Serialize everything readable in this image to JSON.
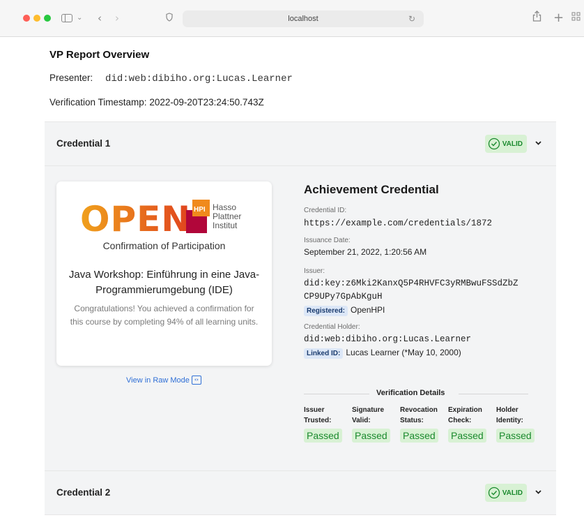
{
  "browser": {
    "address": "localhost"
  },
  "report": {
    "title": "VP Report Overview",
    "presenter_label": "Presenter:",
    "presenter_value": "did:web:dibiho.org:Lucas.Learner",
    "timestamp_label": "Verification Timestamp:",
    "timestamp_value": "2022-09-20T23:24:50.743Z"
  },
  "credentials": [
    {
      "title": "Credential 1",
      "status": "VALID"
    },
    {
      "title": "Credential 2",
      "status": "VALID"
    }
  ],
  "card": {
    "logo_text": "OPEN",
    "logo_badge": "HPI",
    "logo_org_1": "Hasso",
    "logo_org_2": "Plattner",
    "logo_org_3": "Institut",
    "subtitle": "Confirmation of Participation",
    "course": "Java Workshop: Einführung in eine Java- Programmierumgebung (IDE)",
    "description": "Congratulations! You achieved a confirmation for this course by completing 94% of all learning units.",
    "raw_link": "View in Raw Mode"
  },
  "details": {
    "heading": "Achievement Credential",
    "credential_id_label": "Credential ID:",
    "credential_id": "https://example.com/credentials/1872",
    "issuance_label": "Issuance Date:",
    "issuance_date": "September 21, 2022, 1:20:56 AM",
    "issuer_label": "Issuer:",
    "issuer_line1": "did:key:z6Mki2KanxQ5P4RHVFC3yRMBwuFSSdZbZ",
    "issuer_line2": "CP9UPy7GpAbKguH",
    "registered_tag": "Registered:",
    "registered_value": "OpenHPI",
    "holder_label": "Credential Holder:",
    "holder": "did:web:dibiho.org:Lucas.Learner",
    "linked_tag": "Linked ID:",
    "linked_value": "Lucas Learner (*May 10, 2000)"
  },
  "verification": {
    "title": "Verification Details",
    "checks": [
      {
        "l1": "Issuer",
        "l2": "Trusted:",
        "result": "Passed"
      },
      {
        "l1": "Signature",
        "l2": "Valid:",
        "result": "Passed"
      },
      {
        "l1": "Revocation",
        "l2": "Status:",
        "result": "Passed"
      },
      {
        "l1": "Expiration",
        "l2": "Check:",
        "result": "Passed"
      },
      {
        "l1": "Holder",
        "l2": "Identity:",
        "result": "Passed"
      }
    ]
  },
  "colors": {
    "valid_bg": "#d8f1d4",
    "valid_text": "#1b8a2e",
    "link": "#2f6fd6",
    "logo_orange": "#e8622c",
    "logo_red": "#b1063a"
  },
  "icons": [
    "back-icon",
    "forward-icon",
    "shield-icon",
    "reload-icon",
    "share-icon",
    "new-tab-icon",
    "tabs-grid-icon",
    "check-circle-icon",
    "chevron-down-icon",
    "code-icon"
  ]
}
